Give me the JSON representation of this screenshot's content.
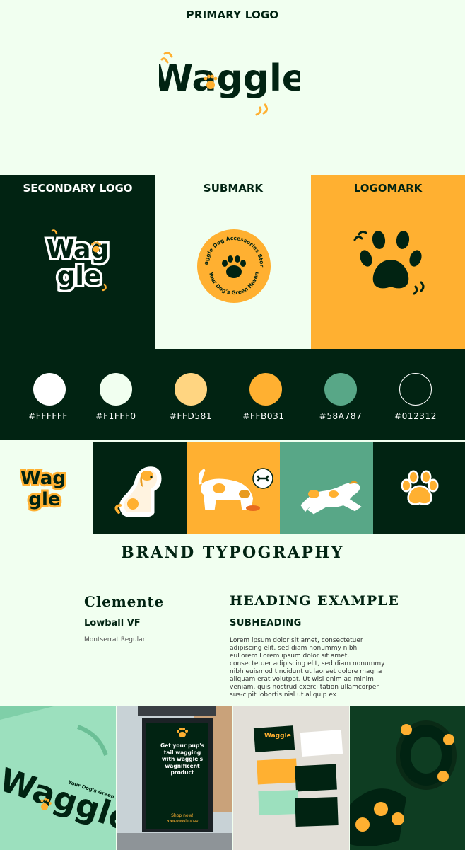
{
  "primary": {
    "title": "PRIMARY LOGO",
    "logo_text": "Waggle"
  },
  "logos": {
    "secondary_title": "SECONDARY LOGO",
    "secondary_line1": "Wag",
    "secondary_line2": "gle",
    "submark_title": "SUBMARK",
    "submark_top_text": "Waggle Dog Accessories Store",
    "submark_bottom_text": "Your Dog's Green Haven",
    "logomark_title": "LOGOMARK"
  },
  "palette": [
    {
      "hex": "#FFFFFF",
      "label": "#FFFFFF"
    },
    {
      "hex": "#F1FFF0",
      "label": "#F1FFF0"
    },
    {
      "hex": "#FFD581",
      "label": "#FFD581"
    },
    {
      "hex": "#FFB031",
      "label": "#FFB031"
    },
    {
      "hex": "#58A787",
      "label": "#58A787"
    },
    {
      "hex": "#012312",
      "label": "#012312"
    }
  ],
  "stickers": {
    "logo_line1": "Wag",
    "logo_line2": "gle"
  },
  "typography": {
    "title": "BRAND TYPOGRAPHY",
    "font_name": "Clemente",
    "font_variant": "Lowball VF",
    "body_font": "Montserrat Regular",
    "heading_example": "HEADING EXAMPLE",
    "subheading_example": "SUBHEADING",
    "body_example": "Lorem ipsum dolor sit amet, consectetuer adipiscing elit, sed diam nonummy nibh euLorem Lorem ipsum dolor sit amet, consectetuer adipiscing elit, sed diam nonummy nibh euismod tincidunt ut laoreet dolore magna aliquam erat volutpat. Ut wisi enim ad minim veniam, quis nostrud exerci tation ullamcorper sus-cipit lobortis nisl ut aliquip ex"
  },
  "mockups": {
    "shirt_logo": "Waggle",
    "shirt_tagline": "Your Dog's Green Haven",
    "poster_text": "Get your pup's tail wagging with waggle's wagnificent product",
    "poster_cta": "Shop now!",
    "poster_url": "www.waggle.shop",
    "card_logo": "Waggle"
  },
  "colors": {
    "dark_green": "#012312",
    "mint": "#F1FFF0",
    "light_yellow": "#FFD581",
    "orange": "#FFB031",
    "sage": "#58A787",
    "white": "#FFFFFF"
  }
}
